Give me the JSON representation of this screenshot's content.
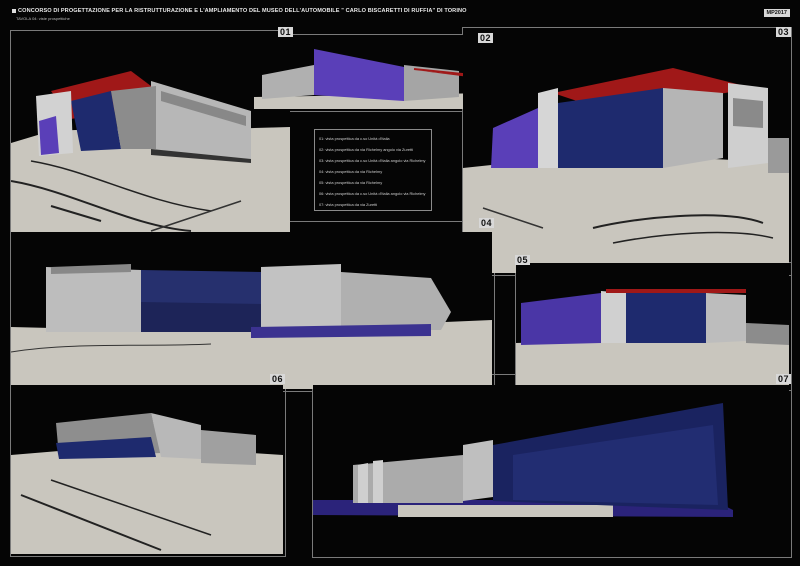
{
  "header": {
    "title": "CONCORSO DI PROGETTAZIONE PER LA RISTRUTTURAZIONE E L'AMPLIAMENTO DEL MUSEO DELL'AUTOMOBILE \" CARLO BISCARETTI DI RUFFIA\" DI TORINO",
    "subtitle": "TAVOLA 04: viste prospettiche",
    "code": "MP2017"
  },
  "labels": {
    "v01": "01",
    "v02": "02",
    "v03": "03",
    "v04": "04",
    "v05": "05",
    "v06": "06",
    "v07": "07"
  },
  "legend": [
    "01: vista prospettica   da c.so Unità d'Italia",
    "02: vista prospettica   da via Richelmy angolo via Zuretti",
    "03: vista prospettica   da c.so Unità d'Italia angolo via Richelmy",
    "04: vista prospettica   da via Richelmy",
    "05: vista prospettica   da via Richelmy",
    "06: vista prospettica   da c.so Unità d'Italia angolo via Richelmy",
    "07: vista prospettica   da via Zuretti"
  ],
  "colors": {
    "background": "#050505",
    "ground": "#c8c5bd",
    "building": "#a9a9a9",
    "glass": "#1e2a6e",
    "violet": "#5a3fb8",
    "roof_red": "#a01818",
    "frame": "#7a7a7a"
  }
}
